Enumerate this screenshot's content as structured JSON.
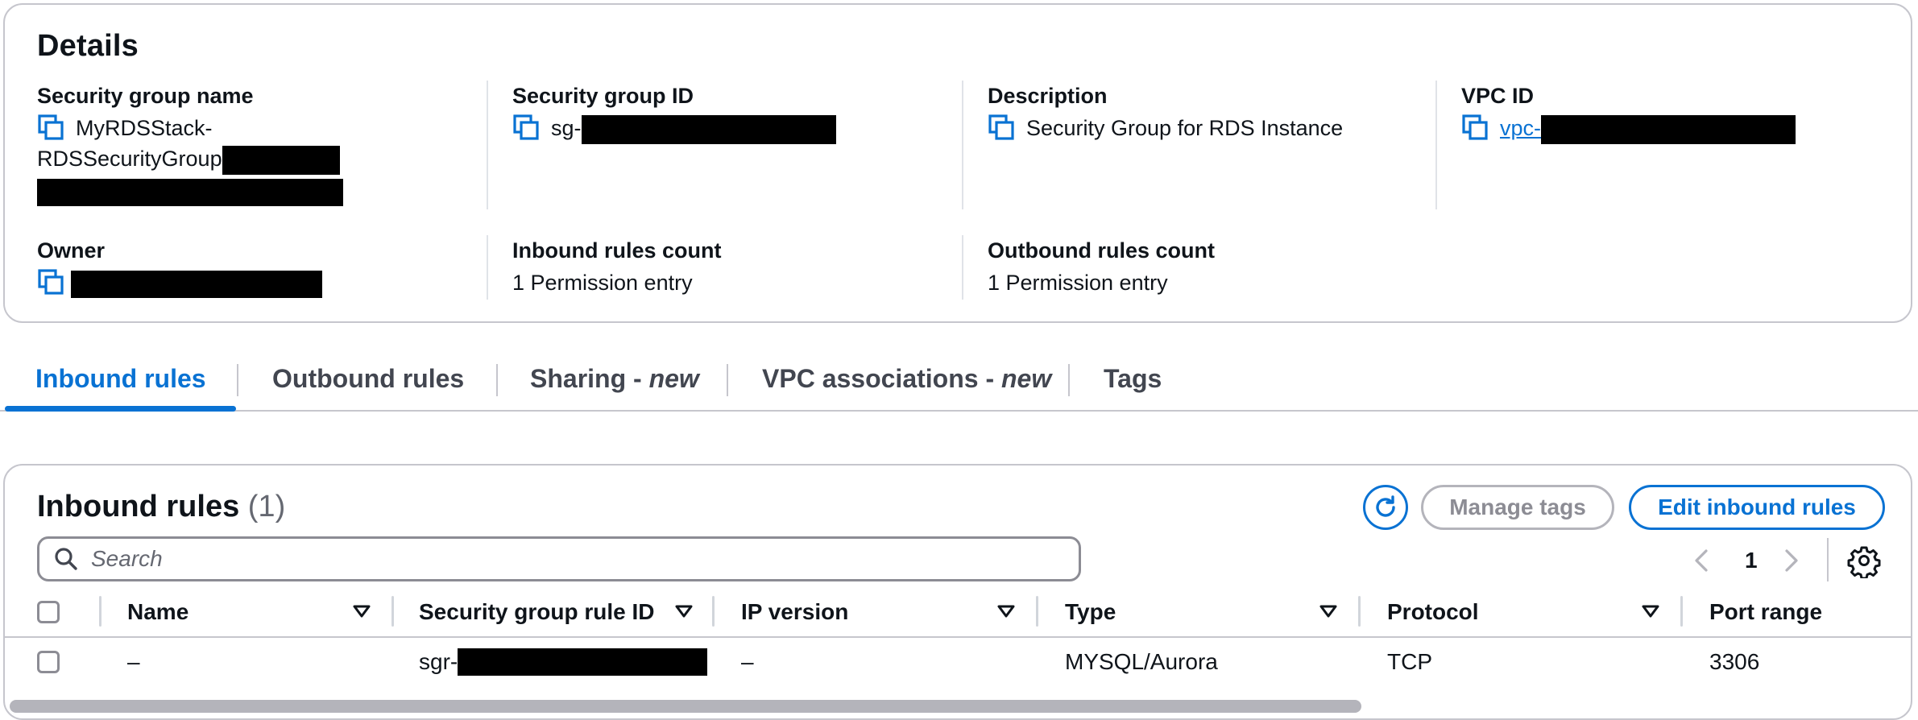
{
  "details": {
    "title": "Details",
    "security_group_name": {
      "label": "Security group name",
      "value_line1": "MyRDSStack-",
      "value_line2": "RDSSecurityGroup"
    },
    "security_group_id": {
      "label": "Security group ID",
      "value": "sg-"
    },
    "description": {
      "label": "Description",
      "value": "Security Group for RDS Instance"
    },
    "vpc_id": {
      "label": "VPC ID",
      "value": "vpc-"
    },
    "owner": {
      "label": "Owner"
    },
    "inbound_rules_count": {
      "label": "Inbound rules count",
      "value": "1 Permission entry"
    },
    "outbound_rules_count": {
      "label": "Outbound rules count",
      "value": "1 Permission entry"
    }
  },
  "tabs": [
    {
      "label": "Inbound rules",
      "suffix": "",
      "active": true
    },
    {
      "label": "Outbound rules",
      "suffix": "",
      "active": false
    },
    {
      "label": "Sharing - ",
      "suffix": "new",
      "active": false
    },
    {
      "label": "VPC associations - ",
      "suffix": "new",
      "active": false
    },
    {
      "label": "Tags",
      "suffix": "",
      "active": false
    }
  ],
  "inbound": {
    "title": "Inbound rules",
    "count": "(1)",
    "manage_tags_label": "Manage tags",
    "edit_label": "Edit inbound rules",
    "search_placeholder": "Search",
    "current_page": "1",
    "columns": [
      "Name",
      "Security group rule ID",
      "IP version",
      "Type",
      "Protocol",
      "Port range"
    ],
    "rows": [
      {
        "name": "–",
        "rule_id": "sgr-",
        "ip_version": "–",
        "type": "MYSQL/Aurora",
        "protocol": "TCP",
        "port_range": "3306"
      }
    ]
  },
  "colors": {
    "accent": "#0972d3",
    "text": "#0f141a",
    "border": "#c6c6cd",
    "disabled": "#8c8c94"
  },
  "icons": [
    "copy-icon",
    "refresh-icon",
    "search-icon",
    "chevron-left-icon",
    "chevron-right-icon",
    "gear-icon",
    "sort-caret-icon"
  ]
}
